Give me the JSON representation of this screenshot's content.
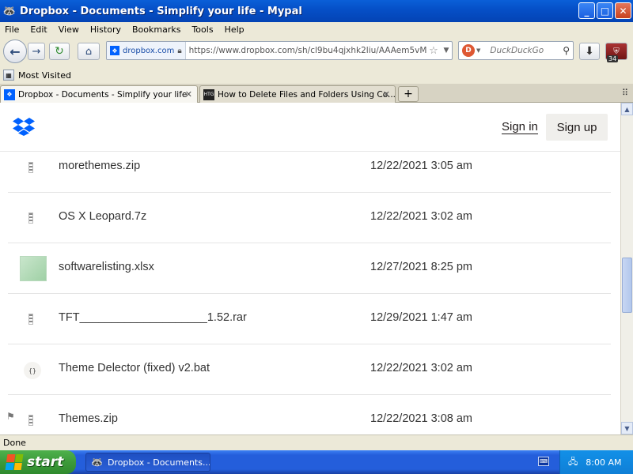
{
  "window": {
    "title": "Dropbox - Documents - Simplify your life - Mypal",
    "buttons": {
      "minimize": "_",
      "maximize": "□",
      "close": "✕"
    }
  },
  "menu": [
    "File",
    "Edit",
    "View",
    "History",
    "Bookmarks",
    "Tools",
    "Help"
  ],
  "nav": {
    "site_identity": "dropbox.com",
    "url": "https://www.dropbox.com/sh/cl9bu4qjxhk2liu/AAAem5vM",
    "search_placeholder": "DuckDuckGo",
    "badge_count": "34"
  },
  "bookmarks": {
    "most_visited": "Most Visited"
  },
  "tabs": [
    {
      "label": "Dropbox - Documents - Simplify your life",
      "icon": "dropbox-icon",
      "active": true
    },
    {
      "label": "How to Delete Files and Folders Using Co...",
      "icon": "htg-icon",
      "favicon_text": "HTG",
      "active": false
    }
  ],
  "tab_new": "+",
  "dropbox": {
    "sign_in": "Sign in",
    "sign_up": "Sign up",
    "files": [
      {
        "name": "morethemes.zip",
        "modified": "12/22/2021 3:05 am",
        "type": "zip"
      },
      {
        "name": "OS X Leopard.7z",
        "modified": "12/22/2021 3:02 am",
        "type": "zip"
      },
      {
        "name": "softwarelisting.xlsx",
        "modified": "12/27/2021 8:25 pm",
        "type": "xlsx"
      },
      {
        "name": "TFT____________________1.52.rar",
        "modified": "12/29/2021 1:47 am",
        "type": "zip"
      },
      {
        "name": "Theme Delector (fixed) v2.bat",
        "modified": "12/22/2021 3:02 am",
        "type": "bat"
      },
      {
        "name": "Themes.zip",
        "modified": "12/22/2021 3:08 am",
        "type": "zip"
      }
    ],
    "bat_icon_text": "{}"
  },
  "status": {
    "text": "Done"
  },
  "taskbar": {
    "start": "start",
    "task_label": "Dropbox - Documents...",
    "clock": "8:00 AM"
  },
  "colors": {
    "dropbox_blue": "#0061fe",
    "xp_blue": "#245edb",
    "start_green": "#3c9a3a"
  }
}
